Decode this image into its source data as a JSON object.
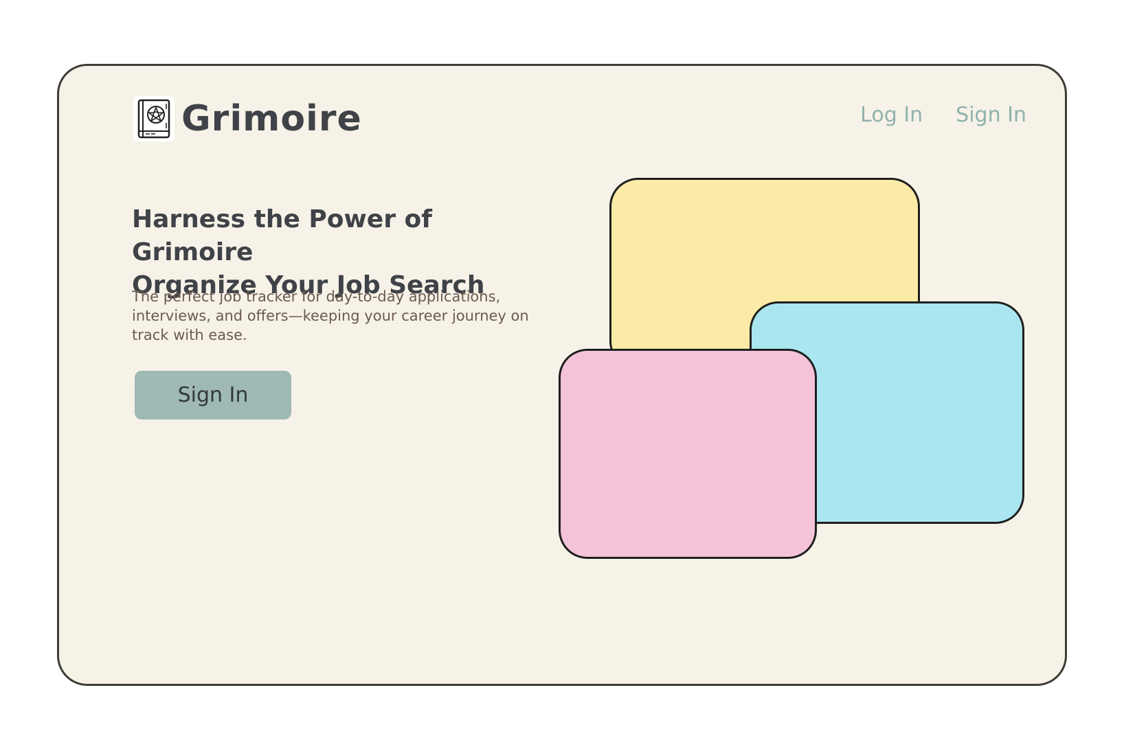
{
  "brand": {
    "name": "Grimoire",
    "icon": "spellbook-icon"
  },
  "nav": {
    "login_label": "Log In",
    "signin_label": "Sign In"
  },
  "hero": {
    "title_line1": "Harness the Power of Grimoire",
    "title_line2": "Organize Your Job Search",
    "subtitle": "The perfect job tracker for day-to-day applications, interviews, and offers—keeping your career journey on track with ease.",
    "cta_label": "Sign In"
  },
  "colors": {
    "background": "#f6f2e8",
    "text": "#3f4247",
    "accent": "#9fb9b4",
    "link": "#8fb2ac",
    "card_yellow": "#fbeba6",
    "card_blue": "#a9e6f0",
    "card_pink": "#f4c3d9"
  }
}
